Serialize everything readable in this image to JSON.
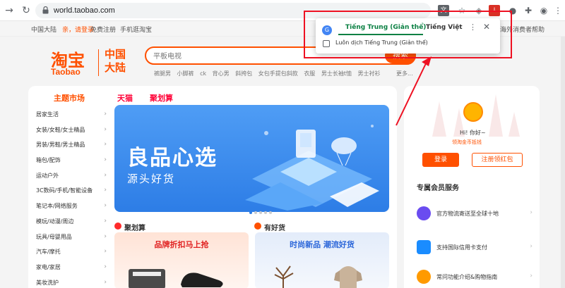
{
  "browser": {
    "url": "world.taobao.com"
  },
  "translate_popup": {
    "tab_source": "Tiếng Trung (Giản thể)",
    "tab_target": "Tiếng Việt",
    "always_translate": "Luôn dịch Tiếng Trung (Giản thể)"
  },
  "sitebar": {
    "region": "中国大陆",
    "greeting": "亲，请登录",
    "register": "免费注册",
    "mobile": "手机逛淘宝",
    "help": "海外消费者帮助"
  },
  "header": {
    "logo_cn": "淘宝",
    "logo_en": "Taobao",
    "region": "中国大陆",
    "search_placeholder": "平板电视",
    "search_button": "搜索",
    "hotwords": [
      "裤腿男",
      "小脚裤",
      "ck",
      "背心男",
      "斜挎包",
      "女包手提包斜款",
      "衣服",
      "男士长袖t恤",
      "男士衬衫"
    ],
    "more": "更多..."
  },
  "tabs": [
    "主题市场",
    "天猫",
    "聚划算"
  ],
  "categories": [
    "居家生活",
    "女装/女鞋/女士精品",
    "男装/男鞋/男士精品",
    "箱包/配饰",
    "运动户外",
    "3C数码/手机/智能设备",
    "笔记本/网络服务",
    "模玩/动漫/周边",
    "玩具/母婴用品",
    "汽车/摩托",
    "家电/家居",
    "美妆洗护"
  ],
  "banner": {
    "title": "良品心选",
    "subtitle": "源头好货"
  },
  "sub_sections": {
    "left_label": "聚划算",
    "left_promo": "品牌折扣马上抢",
    "right_label": "有好货",
    "right_promo": "时尚新品 潮流好货"
  },
  "user_panel": {
    "greeting": "Hi! 你好~",
    "badge": "领淘金币抵钱",
    "login": "登录",
    "register": "注册领红包"
  },
  "services": {
    "title": "专属会员服务",
    "items": [
      "官方物流寄送至全球十地",
      "支持国际信用卡支付",
      "常问功能介绍&购物指南"
    ]
  },
  "colors": {
    "brand": "#ff5000",
    "tmall": "#ff0036",
    "translate_accent": "#0b8043",
    "annotation": "#ee1122"
  }
}
